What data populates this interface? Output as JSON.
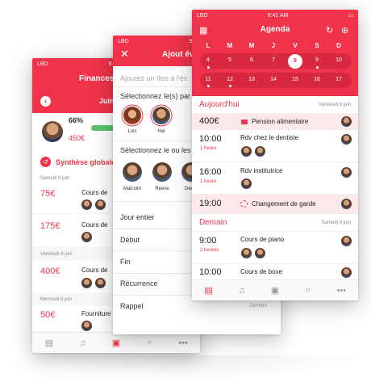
{
  "status": {
    "carrier": "LBD",
    "time": "9:41 AM"
  },
  "finances": {
    "title": "Finances",
    "month": "Juin",
    "percent": "66%",
    "progress": 0.66,
    "amount": "450€",
    "synthese": "Synthèse globale",
    "groups": [
      {
        "date": "Samedi 9 juin",
        "rows": [
          {
            "value": "75€",
            "label": "Cours de"
          },
          {
            "value": "175€",
            "label": "Cours de"
          }
        ]
      },
      {
        "date": "Vendredi 8 juin",
        "rows": [
          {
            "value": "400€",
            "label": "Cours de"
          }
        ]
      },
      {
        "date": "Mercredi 6 juin",
        "rows": [
          {
            "value": "50€",
            "label": "Fourniture"
          }
        ]
      }
    ]
  },
  "ajout": {
    "title": "Ajout év",
    "title_placeholder": "Ajoutez un titre à l'év",
    "select_parents": "Sélectionnez le(s) par",
    "parents": [
      "Lois",
      "Hal"
    ],
    "select_children": "Sélectionnez le ou les",
    "children": [
      "Malcolm",
      "Reese",
      "Dew"
    ],
    "fields": [
      "Jour entier",
      "Début",
      "Fin",
      "Récurrence",
      "Rappel"
    ],
    "rappel_value": "Jamais"
  },
  "agenda": {
    "title": "Agenda",
    "days": [
      "L",
      "M",
      "M",
      "J",
      "V",
      "S",
      "D"
    ],
    "week1": [
      "4",
      "5",
      "6",
      "7",
      "8",
      "9",
      "10"
    ],
    "week2": [
      "11",
      "12",
      "13",
      "14",
      "15",
      "16",
      "17"
    ],
    "today": "8",
    "sections": [
      {
        "title": "Aujourd'hui",
        "date": "Vendredi 8 juin"
      },
      {
        "title": "Demain",
        "date": "Samedi 9 juin"
      }
    ],
    "events": [
      {
        "time": "400€",
        "duration": "",
        "name": "Pension alimentaire"
      },
      {
        "time": "10:00",
        "duration": "1 heure",
        "name": "Rdv chez le dentiste"
      },
      {
        "time": "16:00",
        "duration": "1 heure",
        "name": "Rdv institutrice"
      },
      {
        "time": "19:00",
        "duration": "",
        "name": "Changement de garde"
      },
      {
        "time": "9:00",
        "duration": "2 heures",
        "name": "Cours de piano"
      },
      {
        "time": "10:00",
        "duration": "",
        "name": "Cours de boxe"
      }
    ]
  },
  "tabbar": {
    "icons": [
      "clipboard-icon",
      "bell-icon",
      "wallet-icon",
      "search-icon",
      "more-icon"
    ]
  },
  "colors": {
    "accent": "#f0334a",
    "progress": "#58c26a"
  }
}
